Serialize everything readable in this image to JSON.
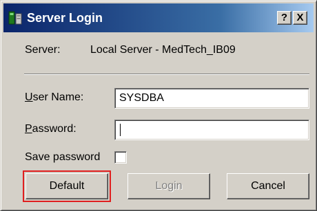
{
  "window": {
    "title": "Server Login",
    "help_label": "?",
    "close_label": "X"
  },
  "server": {
    "label": "Server:",
    "value": "Local Server - MedTech_IB09"
  },
  "username": {
    "label_first": "U",
    "label_rest": "ser Name:",
    "value": "SYSDBA"
  },
  "password": {
    "label_first": "P",
    "label_rest": "assword:",
    "value": ""
  },
  "save_password": {
    "label": "Save password",
    "checked": false
  },
  "buttons": {
    "default_label": "Default",
    "login_label": "Login",
    "cancel_label": "Cancel"
  },
  "colors": {
    "titlebar_start": "#0a246a",
    "titlebar_end": "#a6caf0",
    "dialog_face": "#d4d0c8",
    "highlight_border": "#e01e1e",
    "disabled_text": "#808080"
  },
  "icons": {
    "app": "server-login-app-icon"
  }
}
